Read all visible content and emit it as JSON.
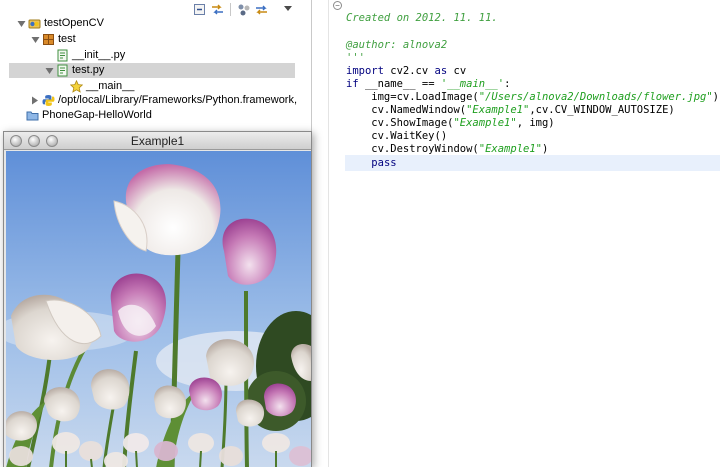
{
  "explorer": {
    "tree": [
      {
        "label": "testOpenCV",
        "icon": "python-project-icon",
        "expanded": true
      },
      {
        "label": "test",
        "icon": "package-icon",
        "expanded": true
      },
      {
        "label": "__init__.py",
        "icon": "python-file-icon"
      },
      {
        "label": "test.py",
        "icon": "python-file-icon",
        "expanded": true,
        "selected": true
      },
      {
        "label": "__main__",
        "icon": "star-icon"
      },
      {
        "label": "/opt/local/Library/Frameworks/Python.framework,",
        "icon": "python-interpreter-icon",
        "expanded": false
      },
      {
        "label": "PhoneGap-HelloWorld",
        "icon": "folder-icon"
      }
    ]
  },
  "cv_window": {
    "title": "Example1"
  },
  "editor": {
    "lines": [
      [
        "'''"
      ],
      [
        "Created on 2012. 11. 11."
      ],
      [
        ""
      ],
      [
        "@author: alnova2"
      ],
      [
        "'''"
      ],
      [
        "import",
        " cv2.cv ",
        "as",
        " cv"
      ],
      [
        "if",
        " __name__ == ",
        "'__main__'",
        ":"
      ],
      [
        "    img=cv.LoadImage(",
        "\"/Users/alnova2/Downloads/flower.jpg\"",
        ")"
      ],
      [
        "    cv.NamedWindow(",
        "\"Example1\"",
        ",cv.CV_WINDOW_AUTOSIZE)"
      ],
      [
        "    cv.ShowImage(",
        "\"Example1\"",
        ", img)"
      ],
      [
        "    cv.WaitKey()"
      ],
      [
        "    cv.DestroyWindow(",
        "\"Example1\"",
        ")"
      ],
      [
        "    ",
        "pass"
      ]
    ]
  },
  "colors": {
    "comment": "#3f9f3f",
    "keyword": "#00007f",
    "string": "#1f9f1f",
    "selection": "#d4d4d4",
    "current_line": "#e8f0fc"
  }
}
